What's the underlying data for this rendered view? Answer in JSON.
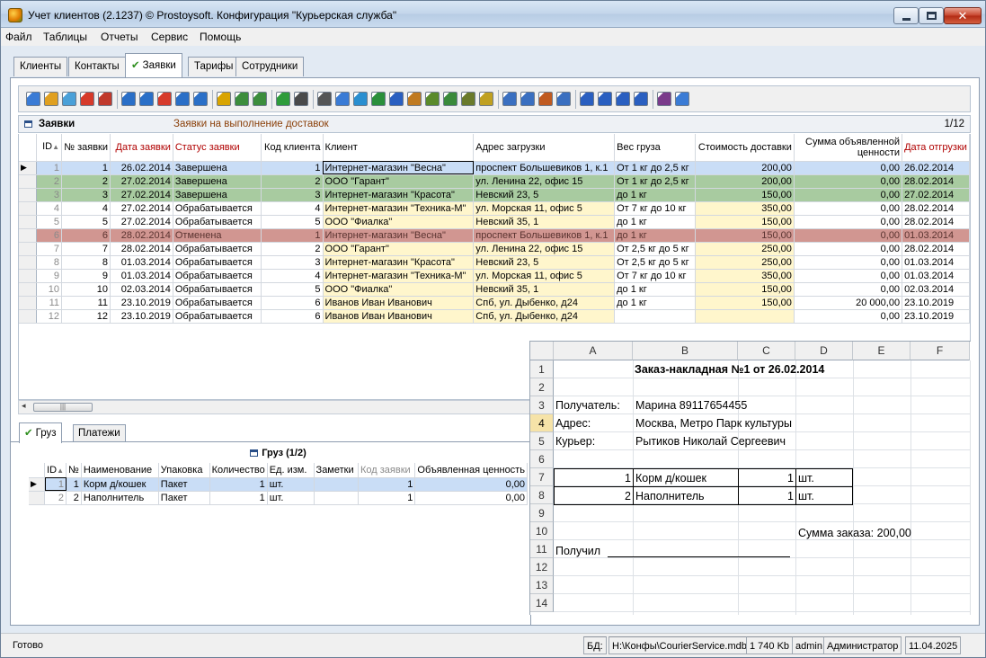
{
  "window": {
    "title": "Учет клиентов (2.1237) © Prostoysoft. Конфигурация \"Курьерская служба\""
  },
  "menu": [
    "Файл",
    "Таблицы",
    "Отчеты",
    "Сервис",
    "Помощь"
  ],
  "main_tabs": [
    "Клиенты",
    "Контакты",
    "Заявки",
    "Тарифы",
    "Сотрудники"
  ],
  "toolbar_icons": [
    "add-record-icon",
    "edit-record-icon",
    "copy-record-icon",
    "delete-record-icon",
    "delete-all-icon",
    "filter-icon",
    "filter-remove-icon",
    "filter-clear-icon",
    "filter-advanced-icon",
    "filter-by-selection-icon",
    "group-icon",
    "sql-query-icon",
    "sql-icon",
    "refresh-icon",
    "find-icon",
    "print-icon",
    "print-preview-icon",
    "export-icon",
    "export-excel-icon",
    "export-word-icon",
    "export-html-icon",
    "export-xml-icon",
    "export-csv-icon",
    "export-txt-icon",
    "chart-icon",
    "sort-asc-icon",
    "sort-desc-icon",
    "columns-icon",
    "settings-icon",
    "first-record-icon",
    "prev-record-icon",
    "next-record-icon",
    "last-record-icon",
    "spellcheck-icon",
    "report-icon"
  ],
  "grid": {
    "title": "Заявки",
    "subtitle": "Заявки на выполнение доставок",
    "pager": "1/12",
    "columns": [
      "ID",
      "№ заявки",
      "Дата заявки",
      "Статус заявки",
      "Код клиента",
      "Клиент",
      "Адрес загрузки",
      "Вес груза",
      "Стоимость доставки",
      "Сумма объявленной ценности",
      "Дата отгрузки"
    ],
    "rows": [
      {
        "id": "1",
        "num": "1",
        "date": "26.02.2014",
        "status": "Завершена",
        "code": "1",
        "client": "Интернет-магазин \"Весна\"",
        "addr": "проспект Большевиков 1, к.1",
        "weight": "От 1 кг до 2,5 кг",
        "cost": "200,00",
        "value": "0,00",
        "ship": "26.02.2014",
        "style": "sel"
      },
      {
        "id": "2",
        "num": "2",
        "date": "27.02.2014",
        "status": "Завершена",
        "code": "2",
        "client": "ООО \"Гарант\"",
        "addr": "ул. Ленина 22, офис 15",
        "weight": "От 1 кг до 2,5 кг",
        "cost": "200,00",
        "value": "0,00",
        "ship": "28.02.2014",
        "style": "green"
      },
      {
        "id": "3",
        "num": "3",
        "date": "27.02.2014",
        "status": "Завершена",
        "code": "3",
        "client": "Интернет-магазин \"Красота\"",
        "addr": "Невский 23, 5",
        "weight": "до 1 кг",
        "cost": "150,00",
        "value": "0,00",
        "ship": "27.02.2014",
        "style": "green"
      },
      {
        "id": "4",
        "num": "4",
        "date": "27.02.2014",
        "status": "Обрабатывается",
        "code": "4",
        "client": "Интернет-магазин \"Техника-М\"",
        "addr": "ул. Морская 11, офис 5",
        "weight": "От 7 кг до 10 кг",
        "cost": "350,00",
        "value": "0,00",
        "ship": "28.02.2014",
        "style": ""
      },
      {
        "id": "5",
        "num": "5",
        "date": "27.02.2014",
        "status": "Обрабатывается",
        "code": "5",
        "client": "ООО \"Фиалка\"",
        "addr": "Невский 35, 1",
        "weight": "до 1 кг",
        "cost": "150,00",
        "value": "0,00",
        "ship": "28.02.2014",
        "style": ""
      },
      {
        "id": "6",
        "num": "6",
        "date": "28.02.2014",
        "status": "Отменена",
        "code": "1",
        "client": "Интернет-магазин \"Весна\"",
        "addr": "проспект Большевиков 1, к.1",
        "weight": "до 1 кг",
        "cost": "150,00",
        "value": "0,00",
        "ship": "01.03.2014",
        "style": "red"
      },
      {
        "id": "7",
        "num": "7",
        "date": "28.02.2014",
        "status": "Обрабатывается",
        "code": "2",
        "client": "ООО \"Гарант\"",
        "addr": "ул. Ленина 22, офис 15",
        "weight": "От 2,5 кг до 5 кг",
        "cost": "250,00",
        "value": "0,00",
        "ship": "28.02.2014",
        "style": ""
      },
      {
        "id": "8",
        "num": "8",
        "date": "01.03.2014",
        "status": "Обрабатывается",
        "code": "3",
        "client": "Интернет-магазин \"Красота\"",
        "addr": "Невский 23, 5",
        "weight": "От 2,5 кг до 5 кг",
        "cost": "250,00",
        "value": "0,00",
        "ship": "01.03.2014",
        "style": ""
      },
      {
        "id": "9",
        "num": "9",
        "date": "01.03.2014",
        "status": "Обрабатывается",
        "code": "4",
        "client": "Интернет-магазин \"Техника-М\"",
        "addr": "ул. Морская 11, офис 5",
        "weight": "От 7 кг до 10 кг",
        "cost": "350,00",
        "value": "0,00",
        "ship": "01.03.2014",
        "style": ""
      },
      {
        "id": "10",
        "num": "10",
        "date": "02.03.2014",
        "status": "Обрабатывается",
        "code": "5",
        "client": "ООО \"Фиалка\"",
        "addr": "Невский 35, 1",
        "weight": "до 1 кг",
        "cost": "150,00",
        "value": "0,00",
        "ship": "02.03.2014",
        "style": ""
      },
      {
        "id": "11",
        "num": "11",
        "date": "23.10.2019",
        "status": "Обрабатывается",
        "code": "6",
        "client": "Иванов Иван Иванович",
        "addr": "Спб, ул. Дыбенко, д24",
        "weight": "до 1 кг",
        "cost": "150,00",
        "value": "20 000,00",
        "ship": "23.10.2019",
        "style": ""
      },
      {
        "id": "12",
        "num": "12",
        "date": "23.10.2019",
        "status": "Обрабатывается",
        "code": "6",
        "client": "Иванов Иван Иванович",
        "addr": "Спб, ул. Дыбенко, д24",
        "weight": "",
        "cost": "",
        "value": "0,00",
        "ship": "23.10.2019",
        "style": ""
      }
    ]
  },
  "sub_tabs": [
    "Груз",
    "Платежи"
  ],
  "sub_grid": {
    "title": "Груз (1/2)",
    "columns": [
      "ID",
      "№",
      "Наименование",
      "Упаковка",
      "Количество",
      "Ед. изм.",
      "Заметки",
      "Код заявки",
      "Объявленная ценность"
    ],
    "rows": [
      {
        "id": "1",
        "num": "1",
        "name": "Корм д/кошек",
        "pack": "Пакет",
        "qty": "1",
        "unit": "шт.",
        "notes": "",
        "order": "1",
        "value": "0,00",
        "sel": true
      },
      {
        "id": "2",
        "num": "2",
        "name": "Наполнитель",
        "pack": "Пакет",
        "qty": "1",
        "unit": "шт.",
        "notes": "",
        "order": "1",
        "value": "0,00",
        "sel": false
      }
    ]
  },
  "sheet": {
    "col_headers": [
      "A",
      "B",
      "C",
      "D",
      "E",
      "F"
    ],
    "row_headers": [
      "1",
      "2",
      "3",
      "4",
      "5",
      "6",
      "7",
      "8",
      "9",
      "10",
      "11",
      "12",
      "13",
      "14"
    ],
    "active_row": "4",
    "heading": "Заказ-накладная №1 от 26.02.2014",
    "recipient_label": "Получатель:",
    "recipient_value": "Марина 89117654455",
    "address_label": "Адрес:",
    "address_value": "Москва, Метро Парк культуры",
    "courier_label": "Курьер:",
    "courier_value": "Рытиков Николай Сергеевич",
    "items": [
      {
        "n": "1",
        "name": "Корм д/кошек",
        "qty": "1",
        "unit": "шт."
      },
      {
        "n": "2",
        "name": "Наполнитель",
        "qty": "1",
        "unit": "шт."
      }
    ],
    "total": "Сумма заказа: 200,00",
    "received": "Получил"
  },
  "status": {
    "ready": "Готово",
    "db_label": "БД:",
    "db_path": "H:\\Конфы\\CourierService.mdb",
    "size": "1 740 Kb",
    "user": "admin",
    "role": "Администратор",
    "date": "11.04.2025"
  }
}
